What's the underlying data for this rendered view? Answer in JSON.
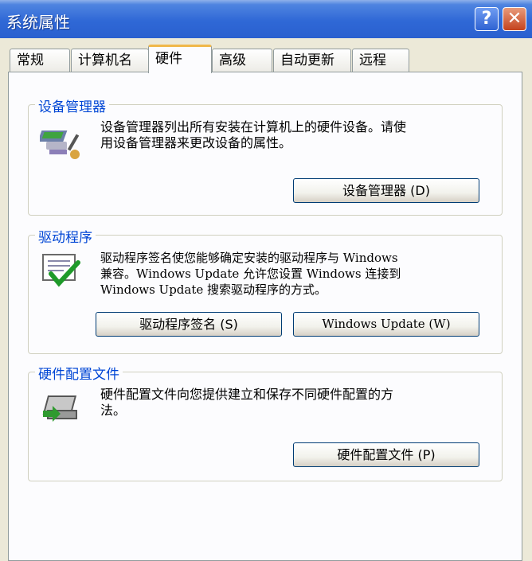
{
  "window": {
    "title": "系统属性"
  },
  "tabs": [
    {
      "label": "常规",
      "active": false
    },
    {
      "label": "计算机名",
      "active": false
    },
    {
      "label": "硬件",
      "active": true
    },
    {
      "label": "高级",
      "active": false
    },
    {
      "label": "自动更新",
      "active": false
    },
    {
      "label": "远程",
      "active": false
    }
  ],
  "device_manager": {
    "title": "设备管理器",
    "description_line1": "设备管理器列出所有安装在计算机上的硬件设备。请使",
    "description_line2": "用设备管理器来更改设备的属性。",
    "button_label": "设备管理器 (D)",
    "icon": "device-manager-icon"
  },
  "drivers": {
    "title": "驱动程序",
    "description_line1": "驱动程序签名使您能够确定安装的驱动程序与 Windows",
    "description_line2": "兼容。Windows Update 允许您设置 Windows 连接到",
    "description_line3": "Windows Update 搜索驱动程序的方式。",
    "signing_button_label": "驱动程序签名 (S)",
    "update_button_label": "Windows Update (W)",
    "icon": "driver-signing-icon"
  },
  "hardware_profiles": {
    "title": "硬件配置文件",
    "description_line1": "硬件配置文件向您提供建立和保存不同硬件配置的方",
    "description_line2": "法。",
    "button_label": "硬件配置文件 (P)",
    "icon": "hardware-profile-icon"
  },
  "colors": {
    "titlebar": "#2f68d6",
    "group_title": "#0046d5",
    "active_tab_accent": "#f0b84a"
  }
}
